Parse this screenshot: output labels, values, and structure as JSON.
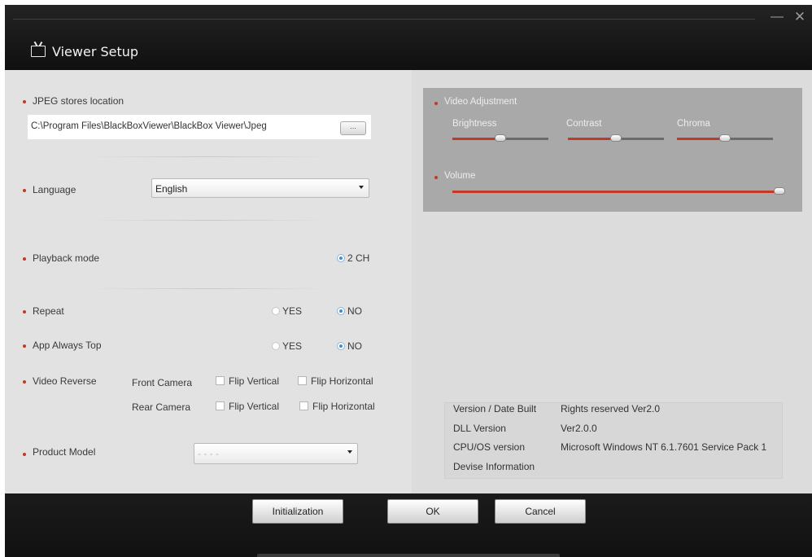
{
  "window": {
    "title": "Viewer Setup",
    "minimize_glyph": "—",
    "close_glyph": "✕"
  },
  "colors": {
    "accent": "#c0392b",
    "panel_left": "#e2e2e2",
    "panel_right": "#dcdcdc",
    "titlebar": "#1c1c1c"
  },
  "jpeg": {
    "label": "JPEG stores location",
    "path": "C:\\Program Files\\BlackBoxViewer\\BlackBox Viewer\\Jpeg",
    "browse_label": "..."
  },
  "language": {
    "label": "Language",
    "selected": "English"
  },
  "playback": {
    "label": "Playback mode",
    "option": "2 CH",
    "selected": true
  },
  "repeat": {
    "label": "Repeat",
    "yes": "YES",
    "no": "NO",
    "value": "NO"
  },
  "always_top": {
    "label": "App Always Top",
    "yes": "YES",
    "no": "NO",
    "value": "NO"
  },
  "video_reverse": {
    "label": "Video Reverse",
    "front": {
      "label": "Front Camera",
      "flip_v": "Flip Vertical",
      "flip_h": "Flip Horizontal",
      "flip_v_checked": false,
      "flip_h_checked": false
    },
    "rear": {
      "label": "Rear Camera",
      "flip_v": "Flip Vertical",
      "flip_h": "Flip Horizontal",
      "flip_v_checked": false,
      "flip_h_checked": false
    }
  },
  "product": {
    "label": "Product Model",
    "selected": "- - - -"
  },
  "video_adjustment": {
    "label": "Video Adjustment",
    "brightness": {
      "label": "Brightness",
      "value": 0.5
    },
    "contrast": {
      "label": "Contrast",
      "value": 0.5
    },
    "chroma": {
      "label": "Chroma",
      "value": 0.5
    },
    "volume": {
      "label": "Volume",
      "value": 1.0
    }
  },
  "info": {
    "version_label": "Version / Date Built",
    "version_value": "Rights reserved Ver2.0",
    "dll_label": "DLL Version",
    "dll_value": "Ver2.0.0",
    "cpu_label": "CPU/OS version",
    "cpu_value": "Microsoft Windows NT 6.1.7601 Service Pack 1",
    "device_label": "Devise Information",
    "device_value": ""
  },
  "footer": {
    "init_label": "Initialization",
    "ok_label": "OK",
    "cancel_label": "Cancel"
  }
}
